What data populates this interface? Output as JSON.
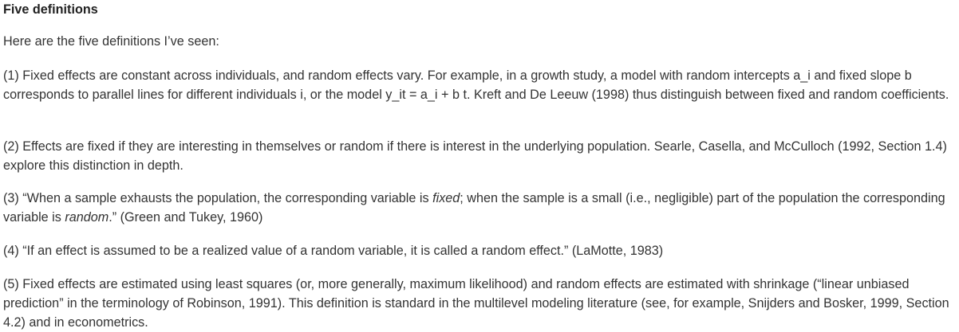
{
  "heading": "Five definitions",
  "intro": "Here are the five definitions I’ve seen:",
  "def1": "(1) Fixed effects are constant across individuals, and random effects vary. For example, in a growth study, a model with random intercepts a_i and fixed slope b corresponds to parallel lines for different individuals i, or the model y_it = a_i + b t. Kreft and De Leeuw (1998) thus distinguish between fixed and random coefficients.",
  "def2": "(2) Effects are fixed if they are interesting in themselves or random if there is interest in the underlying population. Searle, Casella, and McCulloch (1992, Section 1.4) explore this distinction in depth.",
  "def3": {
    "part1": "(3) “When a sample exhausts the population, the corresponding variable is ",
    "em1": "fixed",
    "part2": "; when the sample is a small (i.e., negligible) part of the population the corresponding variable is ",
    "em2": "random",
    "part3": ".” (Green and Tukey, 1960)"
  },
  "def4": "(4) “If an effect is assumed to be a realized value of a random variable, it is called a random effect.” (LaMotte, 1983)",
  "def5": "(5) Fixed effects are estimated using least squares (or, more generally, maximum likelihood) and random effects are estimated with shrinkage (“linear unbiased prediction” in the terminology of Robinson, 1991). This definition is standard in the multilevel modeling literature (see, for example, Snijders and Bosker, 1999, Section 4.2) and in econometrics."
}
